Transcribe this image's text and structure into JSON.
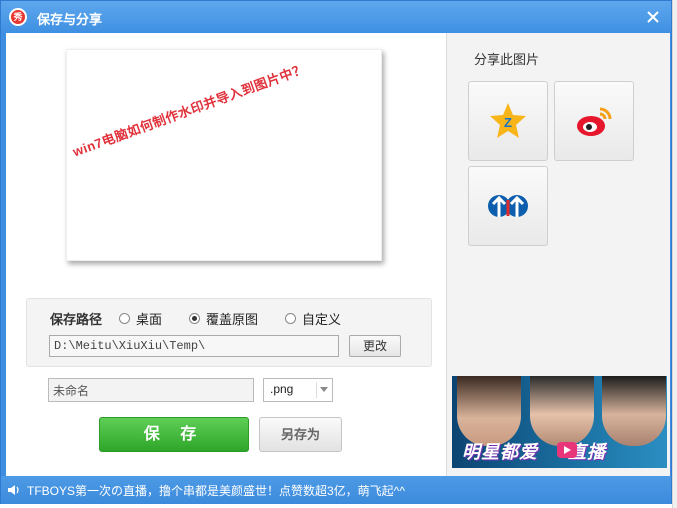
{
  "window": {
    "title": "保存与分享",
    "logo_text": "秀"
  },
  "preview": {
    "watermark_text": "win7电脑如何制作水印并导入到图片中？"
  },
  "save_path": {
    "label": "保存路径",
    "options": [
      {
        "label": "桌面",
        "selected": false
      },
      {
        "label": "覆盖原图",
        "selected": true
      },
      {
        "label": "自定义",
        "selected": false
      }
    ],
    "path_value": "D:\\Meitu\\XiuXiu\\Temp\\",
    "change_label": "更改"
  },
  "file": {
    "name_value": "未命名",
    "format_value": ".png"
  },
  "actions": {
    "save_label": "保 存",
    "save_as_label": "另存为"
  },
  "share": {
    "title": "分享此图片",
    "targets": [
      {
        "icon": "qzone-icon"
      },
      {
        "icon": "weibo-icon"
      },
      {
        "icon": "renren-icon"
      }
    ]
  },
  "banner": {
    "text": "明星都爱",
    "text2": "直播"
  },
  "status": {
    "text": "TFBOYS第一次の直播，撸个串都是美颜盛世！点赞数超3亿，萌飞起^^"
  },
  "colors": {
    "title_bar": "#3f90e2",
    "save_button": "#2ea62a",
    "watermark": "#e0303a"
  }
}
